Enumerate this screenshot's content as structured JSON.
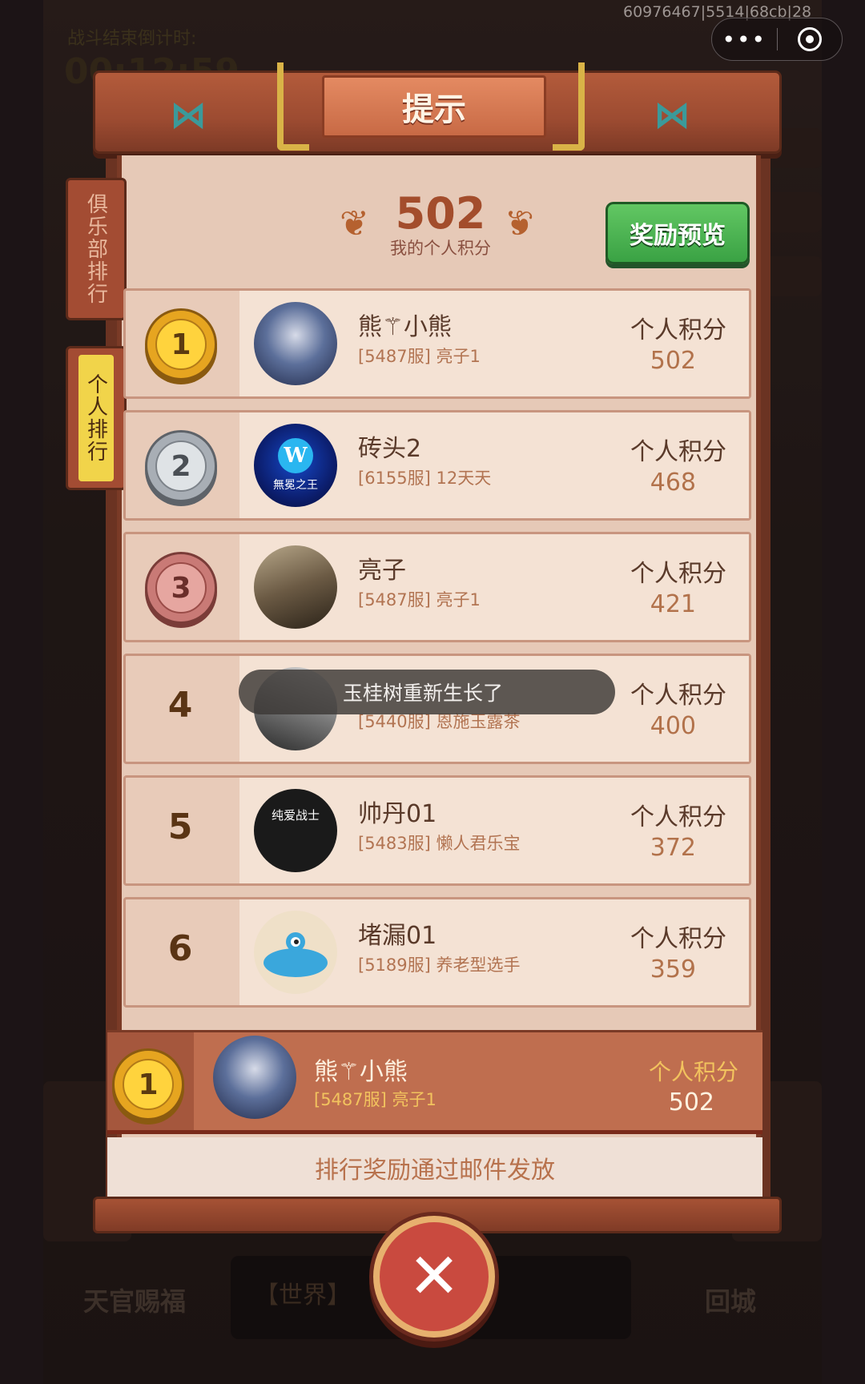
{
  "top_bar": {
    "session_id": "60976467|5514|68cb|28",
    "more_icon": "•••"
  },
  "background": {
    "timer_label": "战斗结束倒计时:",
    "timer_value": "00:12:59",
    "left_button": "天官赐福",
    "right_button": "回城",
    "chat": "【世界】"
  },
  "dialog": {
    "title": "提示",
    "tabs": {
      "club": "俱乐部排行",
      "personal": "个人排行"
    },
    "my_score": "502",
    "my_score_label": "我的个人积分",
    "preview_button": "奖励预览",
    "rows": [
      {
        "rank": "1",
        "name": "熊⚚小熊",
        "server": "[5487服] 亮子1",
        "score_label": "个人积分",
        "score": "502"
      },
      {
        "rank": "2",
        "name": "砖头2",
        "server": "[6155服] 12天天",
        "score_label": "个人积分",
        "score": "468"
      },
      {
        "rank": "3",
        "name": "亮子",
        "server": "[5487服] 亮子1",
        "score_label": "个人积分",
        "score": "421"
      },
      {
        "rank": "4",
        "name": "",
        "server": "[5440服] 恩施玉露茶",
        "score_label": "个人积分",
        "score": "400"
      },
      {
        "rank": "5",
        "name": "帅丹01",
        "server": "[5483服] 懒人君乐宝",
        "score_label": "个人积分",
        "score": "372"
      },
      {
        "rank": "6",
        "name": "堵漏01",
        "server": "[5189服] 养老型选手",
        "score_label": "个人积分",
        "score": "359"
      }
    ],
    "avatar_texts": {
      "w_logo": "W",
      "w_caption": "無冕之王",
      "warrior_caption": "纯爱战士"
    },
    "toast": "玉桂树重新生长了",
    "my_row": {
      "rank": "1",
      "name": "熊⚚小熊",
      "server": "[5487服] 亮子1",
      "score_label": "个人积分",
      "score": "502"
    },
    "mail_note": "排行奖励通过邮件发放",
    "close_icon": "✕"
  }
}
